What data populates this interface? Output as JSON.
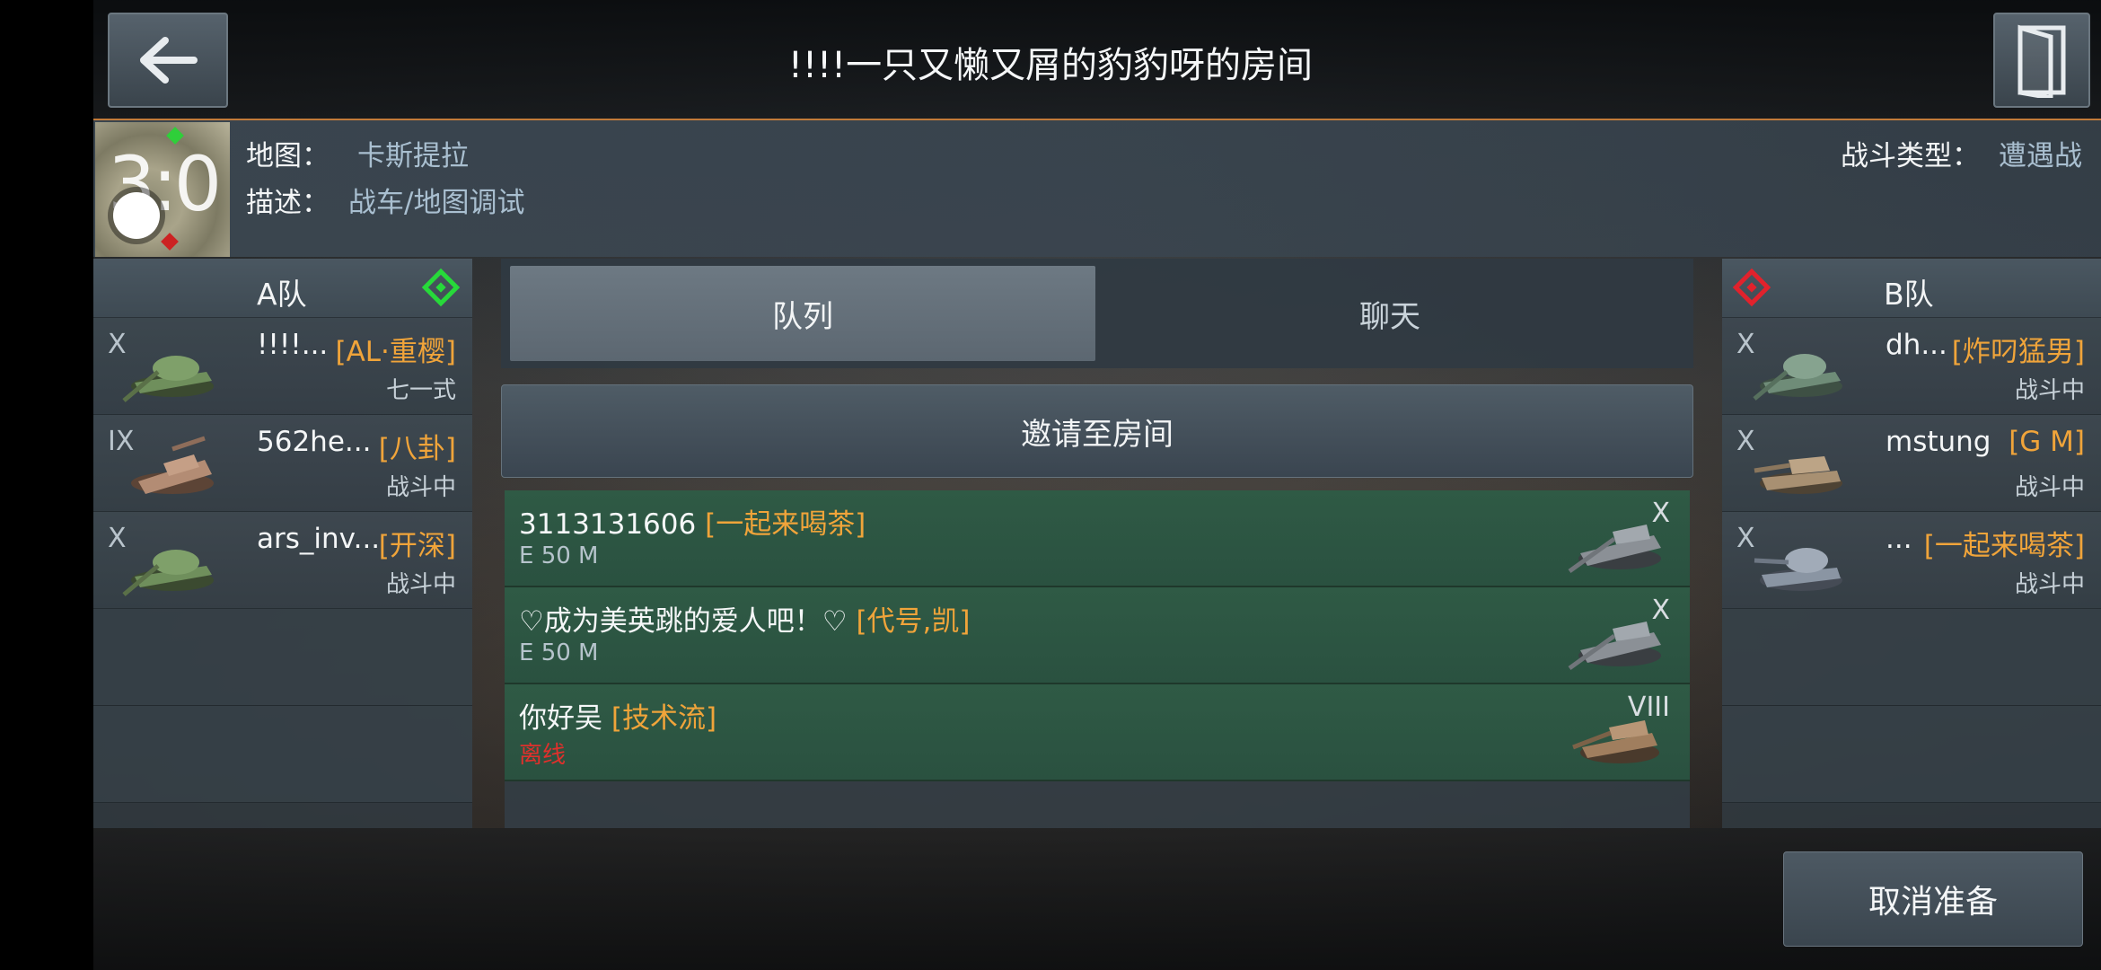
{
  "room": {
    "title": "!!!!一只又懒又屑的豹豹呀的房间"
  },
  "info": {
    "map_label": "地图：",
    "map_value": "卡斯提拉",
    "desc_label": "描述：",
    "desc_value": "战车/地图调试",
    "battle_type_label": "战斗类型：",
    "battle_type_value": "遭遇战",
    "minimap_score": "3:0"
  },
  "team_a": {
    "name": "A队",
    "marker_color": "#27d93a",
    "players": [
      {
        "tier": "X",
        "name": "!!!!...",
        "clan": "[AL·重樱]",
        "status": "七一式",
        "tank_color": "#6f8f5c"
      },
      {
        "tier": "IX",
        "name": "562he...",
        "clan": "[八卦]",
        "status": "战斗中",
        "tank_color": "#b38c74"
      },
      {
        "tier": "X",
        "name": "ars_inv...",
        "clan": "[开深]",
        "status": "战斗中",
        "tank_color": "#6f8f5c"
      }
    ]
  },
  "team_b": {
    "name": "B队",
    "marker_color": "#e1222c",
    "players": [
      {
        "tier": "X",
        "name": "dh...",
        "clan": "[炸叼猛男]",
        "status": "战斗中",
        "tank_color": "#6f8c78"
      },
      {
        "tier": "X",
        "name": "mstung",
        "clan": "[G M]",
        "status": "战斗中",
        "tank_color": "#a89072"
      },
      {
        "tier": "X",
        "name": "...",
        "clan": "[一起来喝茶]",
        "status": "战斗中",
        "tank_color": "#8a95a3"
      }
    ]
  },
  "tabs": {
    "queue": "队列",
    "chat": "聊天"
  },
  "invite_button": "邀请至房间",
  "queue": [
    {
      "name": "3113131606",
      "clan": "[一起来喝茶]",
      "tank": "E 50 M",
      "tier": "X",
      "tank_status": "normal"
    },
    {
      "name": "♡成为美英跳的爱人吧！♡",
      "clan": "[代号,凯]",
      "tank": "E 50 M",
      "tier": "X",
      "tank_status": "normal"
    },
    {
      "name": "你好吴",
      "clan": "[技术流]",
      "tank": "离线",
      "tier": "VIII",
      "tank_status": "offline"
    }
  ],
  "cancel_ready_button": "取消准备",
  "colors": {
    "clan": "#f0a43a",
    "accent_border": "#c27b3a",
    "queue_row": "#2f5a45",
    "offline": "#e0302c"
  }
}
